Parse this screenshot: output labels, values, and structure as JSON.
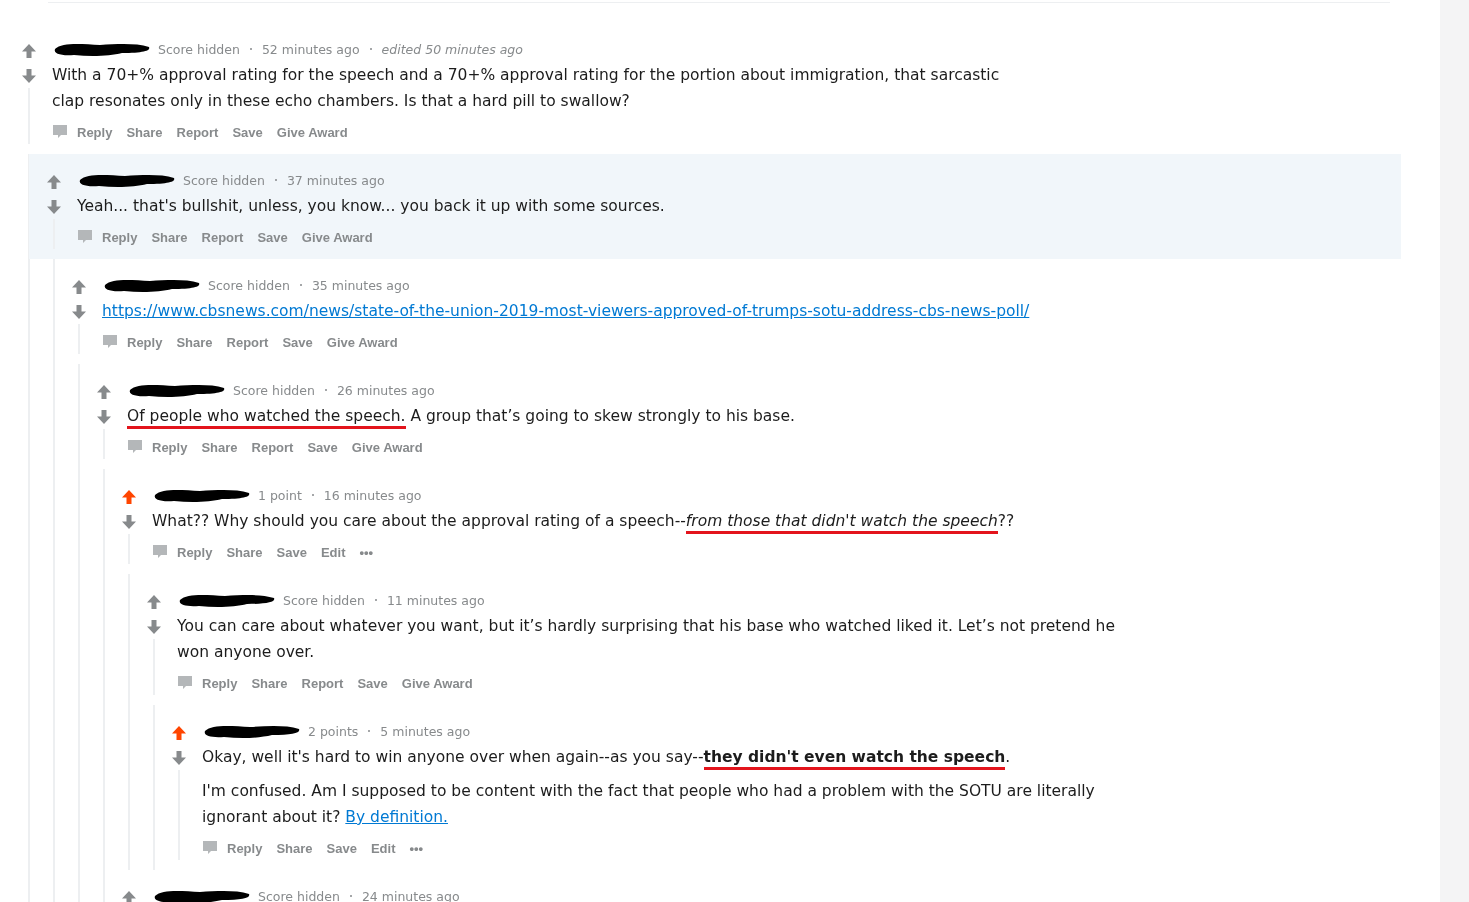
{
  "comments": [
    {
      "score": "Score hidden",
      "time": "52 minutes ago",
      "edited": "edited 50 minutes ago",
      "upvoted": false,
      "highlighted": false,
      "paragraphs": [
        [
          {
            "text": "With a 70+% approval rating for the speech and a 70+% approval rating for the portion about immigration, that sarcastic clap resonates only in these echo chambers. Is that a hard pill to swallow?",
            "kind": "plain",
            "marked": false
          }
        ]
      ],
      "actions": [
        "Reply",
        "Share",
        "Report",
        "Save",
        "Give Award"
      ],
      "children": [
        {
          "score": "Score hidden",
          "time": "37 minutes ago",
          "upvoted": false,
          "highlighted": true,
          "paragraphs": [
            [
              {
                "text": "Yeah... that's bullshit, unless, you know... you back it up with some sources.",
                "kind": "plain",
                "marked": false
              }
            ]
          ],
          "actions": [
            "Reply",
            "Share",
            "Report",
            "Save",
            "Give Award"
          ],
          "children": [
            {
              "score": "Score hidden",
              "time": "35 minutes ago",
              "upvoted": false,
              "highlighted": false,
              "paragraphs": [
                [
                  {
                    "text": "https://www.cbsnews.com/news/state-of-the-union-2019-most-viewers-approved-of-trumps-sotu-address-cbs-news-poll/",
                    "kind": "link",
                    "marked": false
                  }
                ]
              ],
              "actions": [
                "Reply",
                "Share",
                "Report",
                "Save",
                "Give Award"
              ],
              "children": [
                {
                  "score": "Score hidden",
                  "time": "26 minutes ago",
                  "upvoted": false,
                  "highlighted": false,
                  "paragraphs": [
                    [
                      {
                        "text": "Of people who watched the speech.",
                        "kind": "plain",
                        "marked": true
                      },
                      {
                        "text": " A group that’s going to skew strongly to his base.",
                        "kind": "plain",
                        "marked": false
                      }
                    ]
                  ],
                  "actions": [
                    "Reply",
                    "Share",
                    "Report",
                    "Save",
                    "Give Award"
                  ],
                  "children": [
                    {
                      "score": "1 point",
                      "time": "16 minutes ago",
                      "upvoted": true,
                      "highlighted": false,
                      "paragraphs": [
                        [
                          {
                            "text": "What?? Why should you care about the approval rating of a speech--",
                            "kind": "plain",
                            "marked": false
                          },
                          {
                            "text": "from those that didn't watch the speech",
                            "kind": "italic",
                            "marked": true
                          },
                          {
                            "text": "??",
                            "kind": "plain",
                            "marked": false
                          }
                        ]
                      ],
                      "actions": [
                        "Reply",
                        "Share",
                        "Save",
                        "Edit",
                        "•••"
                      ],
                      "children": [
                        {
                          "score": "Score hidden",
                          "time": "11 minutes ago",
                          "upvoted": false,
                          "highlighted": false,
                          "paragraphs": [
                            [
                              {
                                "text": "You can care about whatever you want, but it’s hardly surprising that his base who watched liked it. Let’s not pretend he won anyone over.",
                                "kind": "plain",
                                "marked": false
                              }
                            ]
                          ],
                          "actions": [
                            "Reply",
                            "Share",
                            "Report",
                            "Save",
                            "Give Award"
                          ],
                          "children": [
                            {
                              "score": "2 points",
                              "time": "5 minutes ago",
                              "upvoted": true,
                              "highlighted": false,
                              "paragraphs": [
                                [
                                  {
                                    "text": "Okay, well it's hard to win anyone over when again--as you say--",
                                    "kind": "plain",
                                    "marked": false
                                  },
                                  {
                                    "text": "they didn't even watch the speech",
                                    "kind": "bold",
                                    "marked": true
                                  },
                                  {
                                    "text": ".",
                                    "kind": "plain",
                                    "marked": false
                                  }
                                ],
                                [
                                  {
                                    "text": "I'm confused. Am I supposed to be content with the fact that people who had a problem with the SOTU are literally ignorant about it? ",
                                    "kind": "plain",
                                    "marked": false
                                  },
                                  {
                                    "text": "By definition.",
                                    "kind": "link",
                                    "marked": false
                                  }
                                ]
                              ],
                              "actions": [
                                "Reply",
                                "Share",
                                "Save",
                                "Edit",
                                "•••"
                              ]
                            }
                          ]
                        }
                      ]
                    },
                    {
                      "score": "Score hidden",
                      "time": "24 minutes ago",
                      "upvoted": false,
                      "highlighted": false
                    }
                  ]
                }
              ]
            }
          ]
        }
      ]
    }
  ]
}
